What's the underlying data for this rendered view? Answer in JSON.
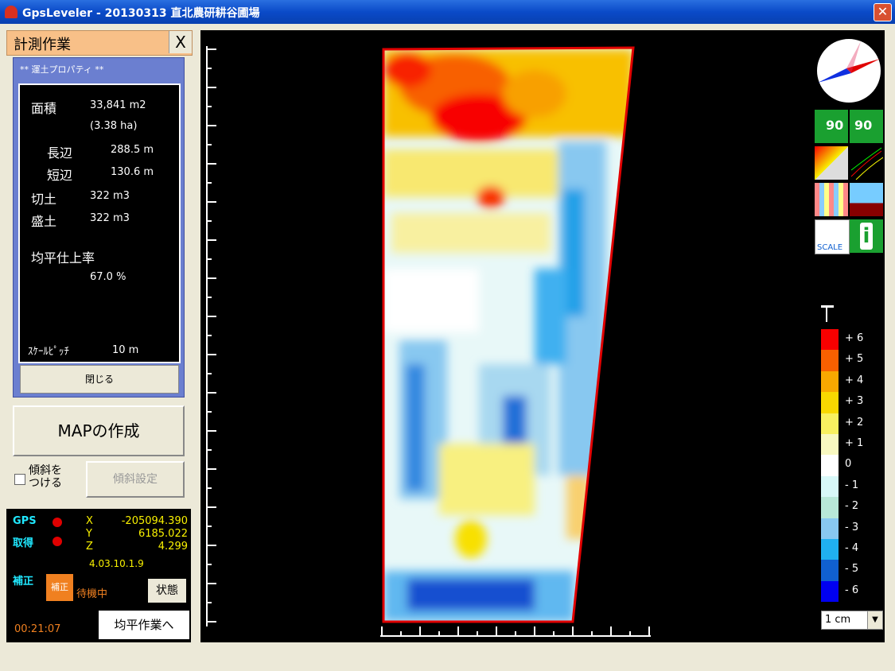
{
  "window": {
    "title": "GpsLeveler - 20130313 直北農研耕谷圃場"
  },
  "panel": {
    "title": "計測作業",
    "close": "X"
  },
  "properties": {
    "caption": "** 運土プロパティ **",
    "area_label": "面積",
    "area_m2": "33,841 m2",
    "area_ha": "(3.38 ha)",
    "long_side_label": "長辺",
    "long_side": "288.5 m",
    "short_side_label": "短辺",
    "short_side": "130.6 m",
    "cut_label": "切土",
    "cut": "322 m3",
    "fill_label": "盛土",
    "fill": "322 m3",
    "finish_rate_label": "均平仕上率",
    "finish_rate": "67.0 %",
    "scale_pitch_label": "ｽｹｰﾙﾋﾟｯﾁ",
    "scale_pitch": "10 m",
    "close_label": "閉じる"
  },
  "buttons": {
    "make_map": "MAPの作成",
    "slope_check": "傾斜を\nつける",
    "slope_setting": "傾斜設定"
  },
  "gps": {
    "gps_label": "GPS",
    "acq_label": "取得",
    "x_label": "X",
    "x": "-205094.390",
    "y_label": "Y",
    "y": "6185.022",
    "z_label": "Z",
    "z": "4.299",
    "version": "4.03.10.1.9",
    "correction_label": "補正",
    "correction_badge": "補正",
    "correction_status": "待機中",
    "state_button": "状態",
    "time": "00:21:07",
    "leveling_button": "均平作業へ"
  },
  "tools": {
    "rotate_left": "90",
    "rotate_right": "90",
    "scale": "SCALE",
    "info": "i"
  },
  "legend": {
    "labels": [
      "+ 6",
      "+ 5",
      "+ 4",
      "+ 3",
      "+ 2",
      "+ 1",
      "0",
      "- 1",
      "- 2",
      "- 3",
      "- 4",
      "- 5",
      "- 6"
    ],
    "colors": [
      "#f80000",
      "#f86000",
      "#f8a800",
      "#f8d800",
      "#f8f060",
      "#f8f8c0",
      "#ffffff",
      "#d8f8f8",
      "#b8e8d8",
      "#88c8f0",
      "#20b0f0",
      "#1060d0",
      "#0000f0"
    ],
    "unit": "1 cm"
  }
}
